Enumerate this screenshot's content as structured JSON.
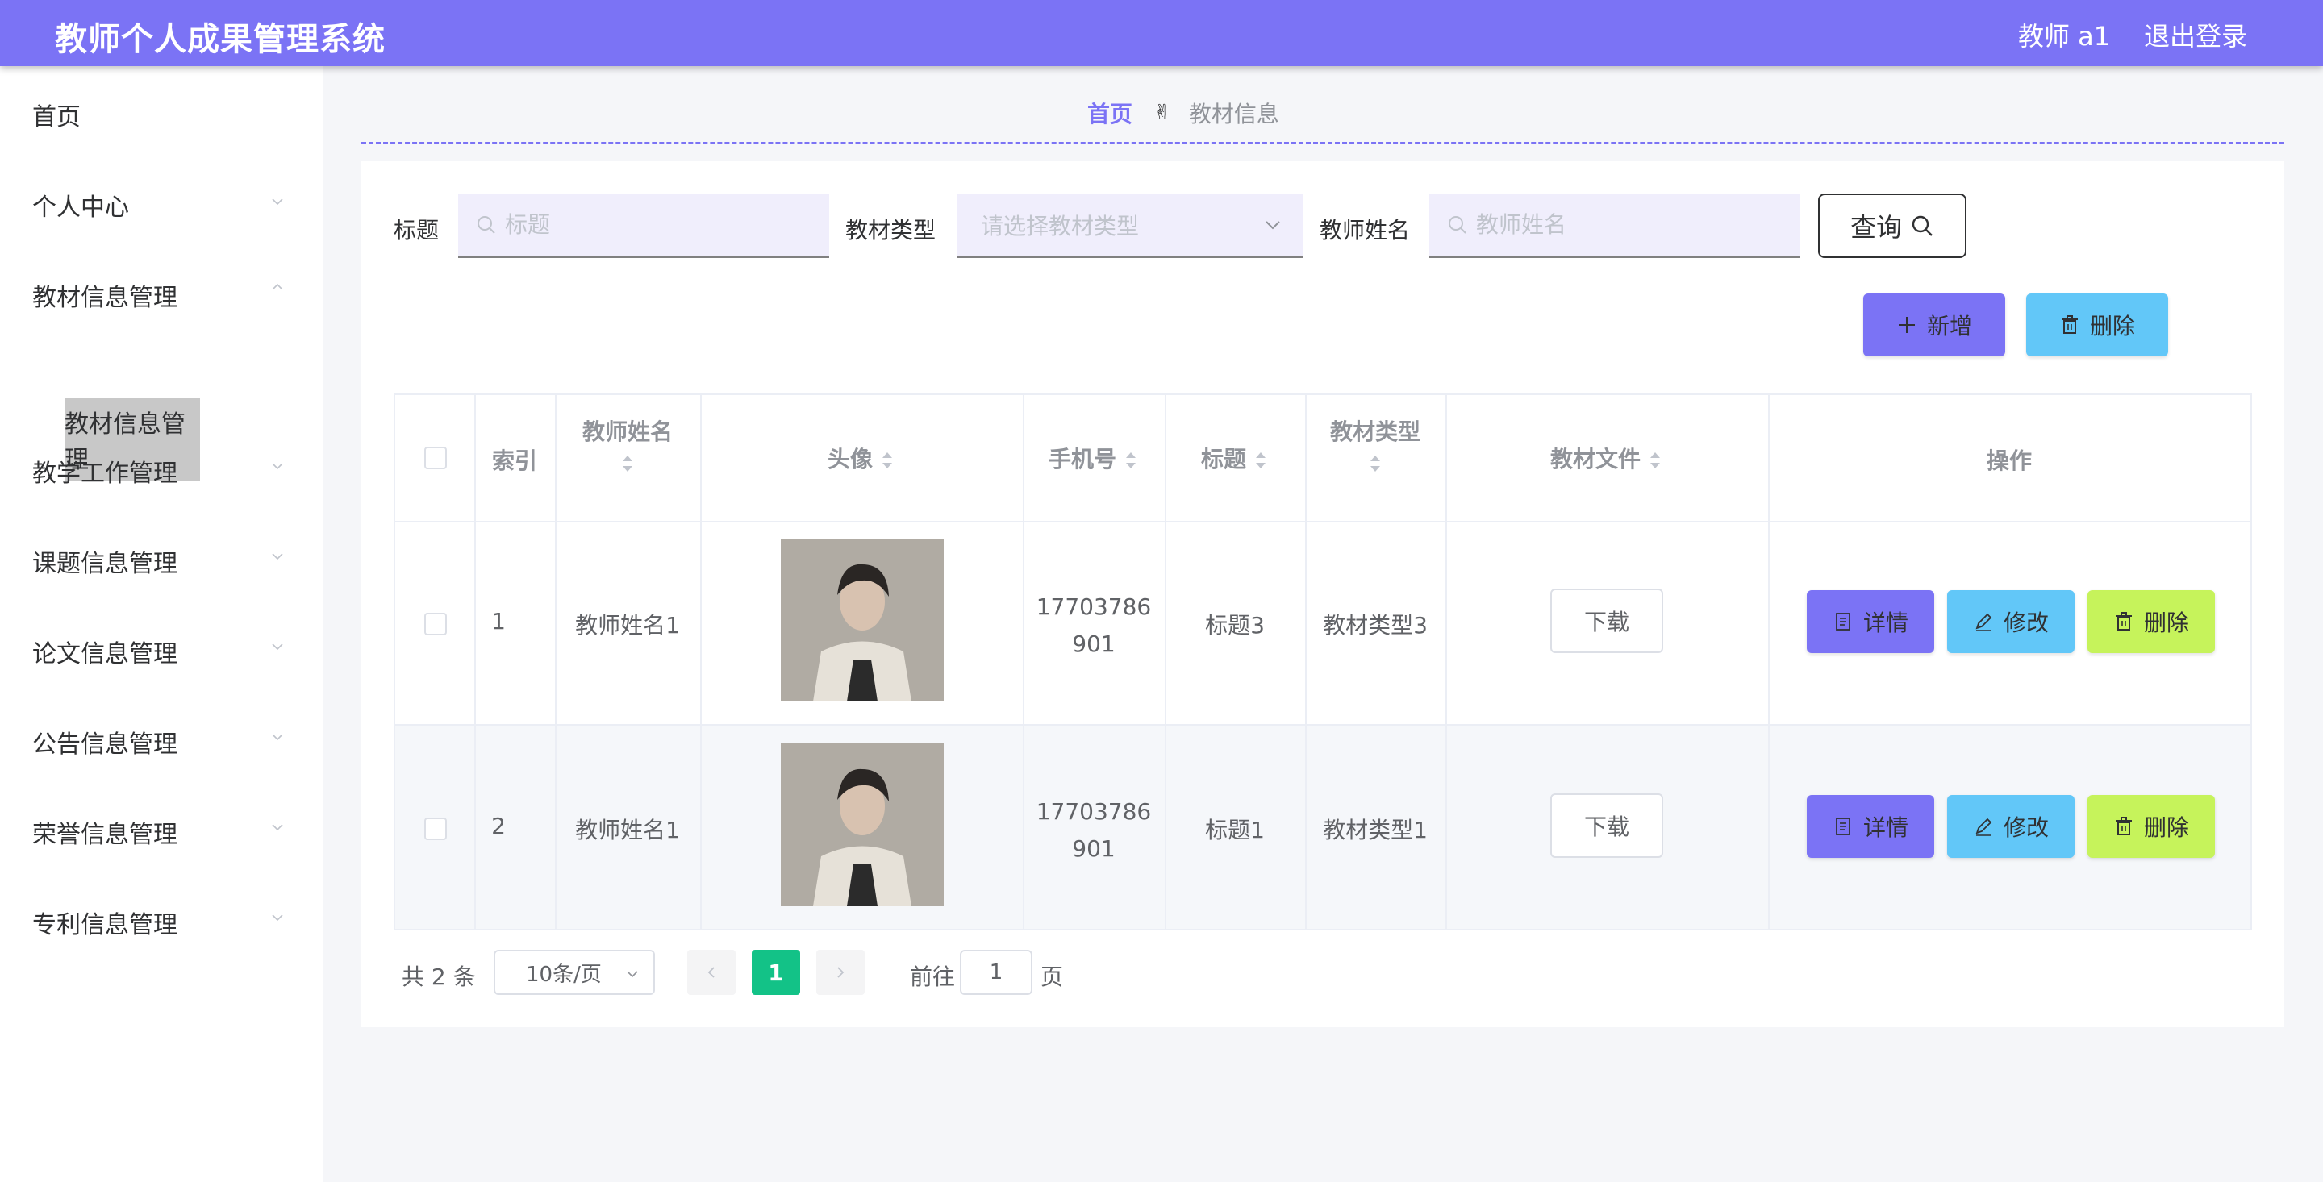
{
  "header": {
    "title": "教师个人成果管理系统",
    "user": "教师 a1",
    "logout": "退出登录"
  },
  "sidebar": {
    "items": [
      {
        "label": "首页"
      },
      {
        "label": "个人中心"
      },
      {
        "label": "教材信息管理"
      },
      {
        "label": "教学工作管理"
      },
      {
        "label": "课题信息管理"
      },
      {
        "label": "论文信息管理"
      },
      {
        "label": "公告信息管理"
      },
      {
        "label": "荣誉信息管理"
      },
      {
        "label": "专利信息管理"
      }
    ],
    "active_sub": "教材信息管理"
  },
  "breadcrumb": {
    "home": "首页",
    "separator": "✌",
    "current": "教材信息"
  },
  "search": {
    "title_label": "标题",
    "title_placeholder": "标题",
    "type_label": "教材类型",
    "type_placeholder": "请选择教材类型",
    "teacher_label": "教师姓名",
    "teacher_placeholder": "教师姓名",
    "query_button": "查询"
  },
  "actions": {
    "add": "新增",
    "delete": "删除"
  },
  "table": {
    "columns": [
      "索引",
      "教师姓名",
      "头像",
      "手机号",
      "标题",
      "教材类型",
      "教材文件",
      "操作"
    ],
    "rows": [
      {
        "index": "1",
        "teacher": "教师姓名1",
        "phone_line1": "17703786",
        "phone_line2": "901",
        "title": "标题3",
        "type": "教材类型3",
        "file_button": "下载"
      },
      {
        "index": "2",
        "teacher": "教师姓名1",
        "phone_line1": "17703786",
        "phone_line2": "901",
        "title": "标题1",
        "type": "教材类型1",
        "file_button": "下载"
      }
    ],
    "row_actions": {
      "detail": "详情",
      "edit": "修改",
      "delete": "删除"
    }
  },
  "pagination": {
    "total": "共 2 条",
    "page_size": "10条/页",
    "current_page": "1",
    "goto_label": "前往",
    "goto_value": "1",
    "page_unit": "页"
  },
  "colors": {
    "primary": "#7b73f5",
    "info": "#62c7f8",
    "lime": "#c6f35b",
    "success": "#13c287"
  }
}
